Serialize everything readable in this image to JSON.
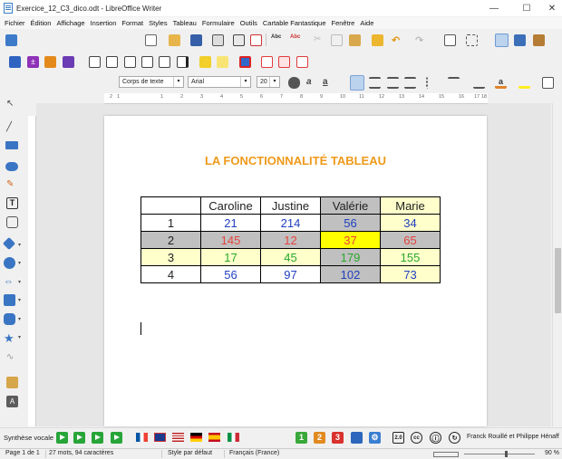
{
  "window": {
    "title": "Exercice_12_C3_dico.odt - LibreOffice Writer",
    "controls": {
      "minimize": "—",
      "maximize": "☐",
      "close": "✕"
    }
  },
  "menu": [
    "Fichier",
    "Édition",
    "Affichage",
    "Insertion",
    "Format",
    "Styles",
    "Tableau",
    "Formulaire",
    "Outils",
    "Cartable Fantastique",
    "Fenêtre",
    "Aide"
  ],
  "format_toolbar": {
    "paragraph_style": "Corps de texte",
    "font_name": "Arial",
    "font_size": "20"
  },
  "ruler_numbers": [
    "1",
    "2",
    "1",
    "2",
    "3",
    "4",
    "5",
    "6",
    "7",
    "8",
    "9",
    "10",
    "11",
    "12",
    "13",
    "14",
    "15",
    "16",
    "17",
    "18"
  ],
  "document": {
    "title": "LA FONCTIONNALITÉ TABLEAU",
    "table": {
      "header": [
        "",
        "Caroline",
        "Justine",
        "Valérie",
        "Marie"
      ],
      "rows": [
        {
          "label": "1",
          "values": [
            "21",
            "214",
            "56",
            "34"
          ]
        },
        {
          "label": "2",
          "values": [
            "145",
            "12",
            "37",
            "65"
          ]
        },
        {
          "label": "3",
          "values": [
            "17",
            "45",
            "179",
            "155"
          ]
        },
        {
          "label": "4",
          "values": [
            "56",
            "97",
            "102",
            "73"
          ]
        }
      ]
    }
  },
  "colors": {
    "title_orange": "#ef9a1a",
    "cell_gray": "#c0c0c0",
    "cell_yellow_light": "#ffffcc",
    "cell_yellow": "#ffff00",
    "text_blue": "#1f3fbf",
    "text_red": "#e8433c",
    "text_green": "#2aa82a",
    "text_black": "#111111"
  },
  "bottom_toolbar": {
    "speech_label": "Synthèse vocale",
    "credits": "Franck Rouillé et Philippe Hénaff"
  },
  "statusbar": {
    "page": "Page 1 de 1",
    "words": "27 mots, 94 caractères",
    "style": "Style par défaut",
    "language": "Français (France)",
    "zoom": "90 %"
  }
}
